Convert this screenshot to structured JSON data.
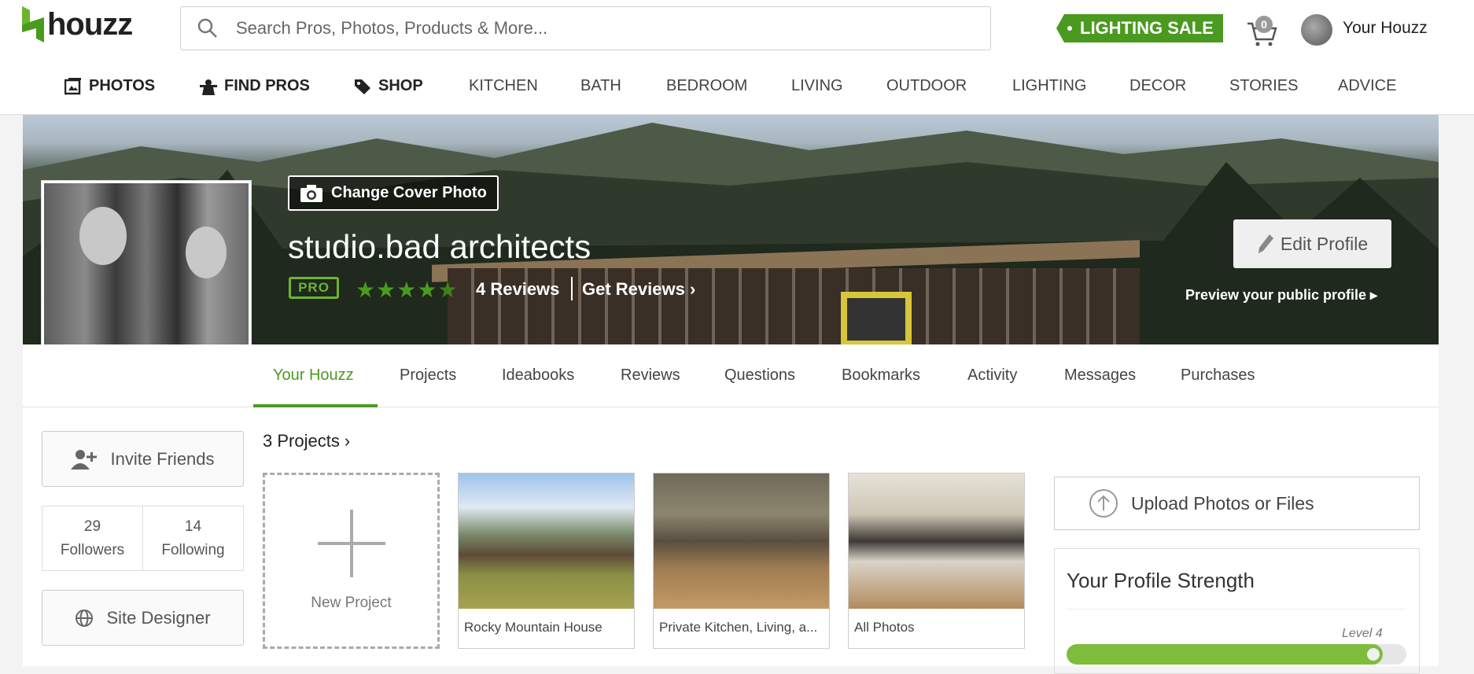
{
  "header": {
    "logo_text": "houzz",
    "search_placeholder": "Search Pros, Photos, Products & More...",
    "sale_label": "LIGHTING SALE",
    "cart_count": "0",
    "user_label": "Your Houzz"
  },
  "nav": [
    {
      "label": "PHOTOS",
      "icon": "photos-icon"
    },
    {
      "label": "FIND PROS",
      "icon": "find-pros-icon"
    },
    {
      "label": "SHOP",
      "icon": "shop-tag-icon"
    },
    {
      "label": "KITCHEN"
    },
    {
      "label": "BATH"
    },
    {
      "label": "BEDROOM"
    },
    {
      "label": "LIVING"
    },
    {
      "label": "OUTDOOR"
    },
    {
      "label": "LIGHTING"
    },
    {
      "label": "DECOR"
    },
    {
      "label": "STORIES"
    },
    {
      "label": "ADVICE"
    }
  ],
  "profile": {
    "change_cover_label": "Change Cover Photo",
    "name": "studio.bad architects",
    "pro_badge": "PRO",
    "rating": 4.5,
    "reviews_label": "4 Reviews",
    "get_reviews_label": "Get Reviews ›",
    "edit_label": "Edit Profile",
    "preview_label": "Preview your public profile ▸"
  },
  "tabs": [
    {
      "label": "Your Houzz",
      "active": true
    },
    {
      "label": "Projects"
    },
    {
      "label": "Ideabooks"
    },
    {
      "label": "Reviews"
    },
    {
      "label": "Questions"
    },
    {
      "label": "Bookmarks"
    },
    {
      "label": "Activity"
    },
    {
      "label": "Messages"
    },
    {
      "label": "Purchases"
    }
  ],
  "sidebar": {
    "invite_label": "Invite Friends",
    "followers_count": "29",
    "followers_label": "Followers",
    "following_count": "14",
    "following_label": "Following",
    "site_designer_label": "Site Designer"
  },
  "projects": {
    "title": "3 Projects ›",
    "new_label": "New Project",
    "items": [
      {
        "label": "Rocky Mountain House"
      },
      {
        "label": "Private Kitchen, Living, a..."
      },
      {
        "label": "All Photos"
      }
    ]
  },
  "right": {
    "upload_label": "Upload Photos or Files",
    "strength_title": "Your Profile Strength",
    "level_label": "Level 4",
    "strength_progress": 0.93
  },
  "colors": {
    "brand_green": "#4a9a1f",
    "accent_green": "#7dbd3b"
  }
}
